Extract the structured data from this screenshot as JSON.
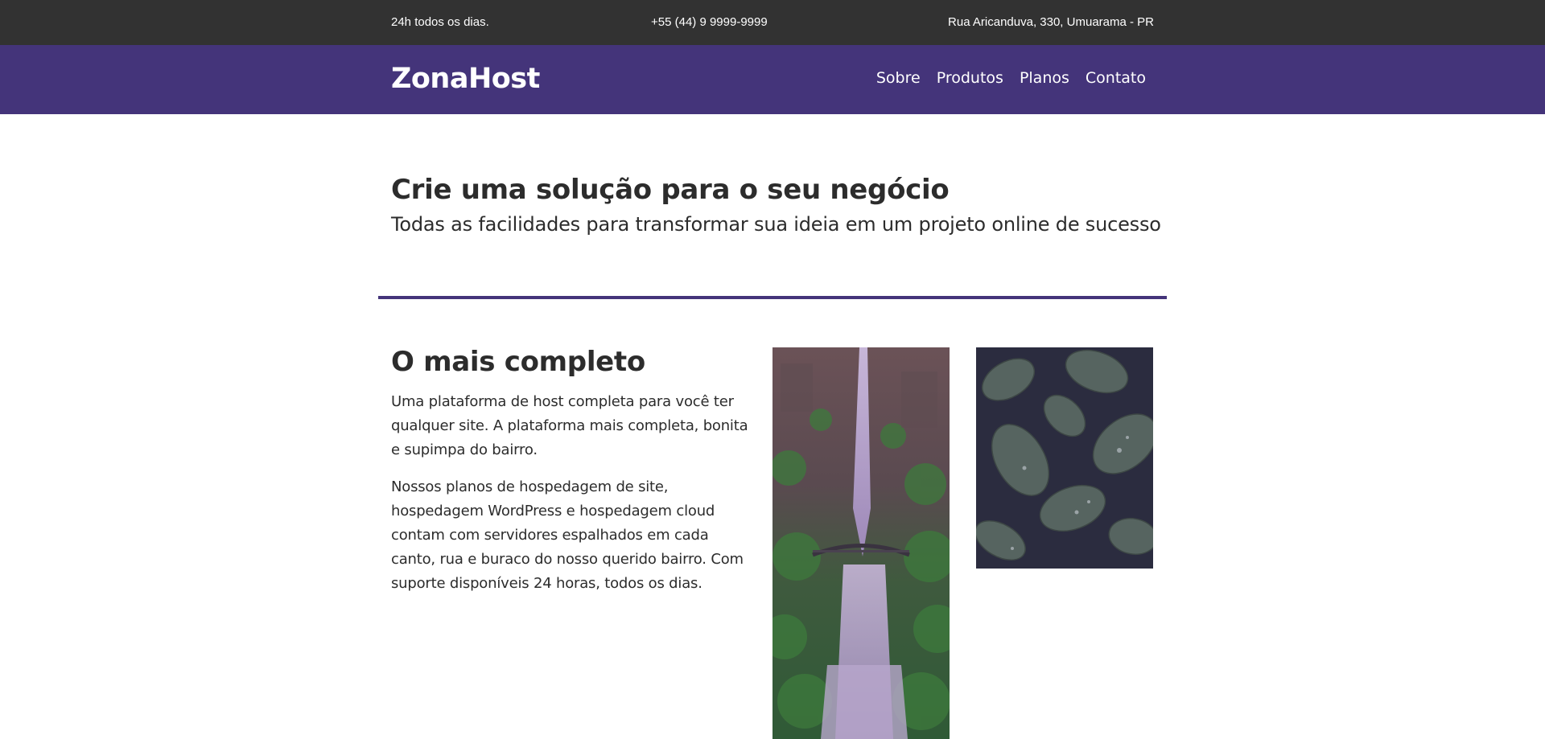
{
  "topbar": {
    "hours": "24h todos os dias.",
    "phone": "+55 (44) 9 9999-9999",
    "address": "Rua Aricanduva, 330, Umuarama - PR"
  },
  "header": {
    "logo": "ZonaHost",
    "nav": [
      "Sobre",
      "Produtos",
      "Planos",
      "Contato"
    ]
  },
  "hero": {
    "title": "Crie uma solução para o seu negócio",
    "subtitle": "Todas as facilidades para transformar sua ideia em um projeto online de sucesso"
  },
  "section": {
    "title": "O mais completo",
    "paragraphs": [
      "Uma plataforma de host completa para você ter qualquer site. A plataforma mais completa, bonita e supimpa do bairro.",
      "Nossos planos de hospedagem de site, hospedagem WordPress e hospedagem cloud contam com servidores espalhados em cada canto, rua e buraco do nosso querido bairro. Com suporte disponíveis 24 horas, todos os dias."
    ]
  },
  "colors": {
    "topbar_bg": "#323232",
    "brand_purple": "#44347a",
    "text": "#2c2c2c"
  }
}
